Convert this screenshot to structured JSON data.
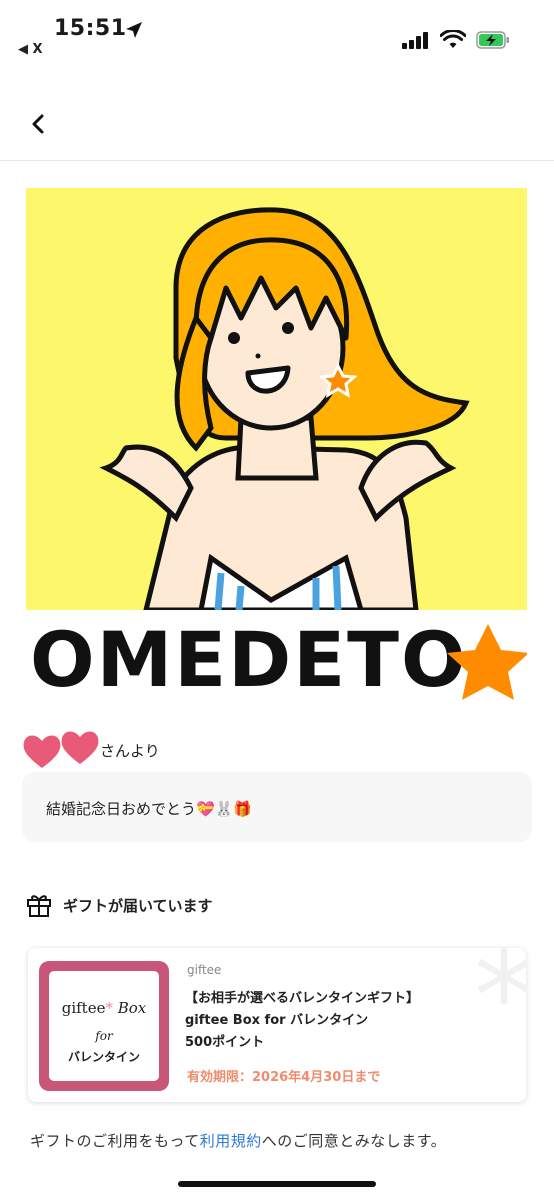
{
  "status_bar": {
    "time": "15:51",
    "back_app_label": "◀ X",
    "accent_battery": "#34c759"
  },
  "hero": {
    "banner_text": "OMEDETO",
    "background_color": "#fdf76b",
    "star_color": "#ff8c00"
  },
  "sender": {
    "label": "さんより",
    "message": "結婚記念日おめでとう💝🐰🎁"
  },
  "gift": {
    "section_title": "ギフトが届いています",
    "brand": "giftee",
    "title_line1": "【お相手が選べるバレンタインギフト】",
    "title_line2": "giftee Box for バレンタイン",
    "title_line3": "500ポイント",
    "expiry": "有効期限：2026年4月30日まで",
    "thumb_title": "giftee",
    "thumb_title_box": "Box",
    "thumb_for": "for",
    "thumb_ja": "バレンタイン"
  },
  "terms": {
    "prefix": "ギフトのご利用をもって",
    "link": "利用規約",
    "suffix": "へのご同意とみなします。"
  }
}
